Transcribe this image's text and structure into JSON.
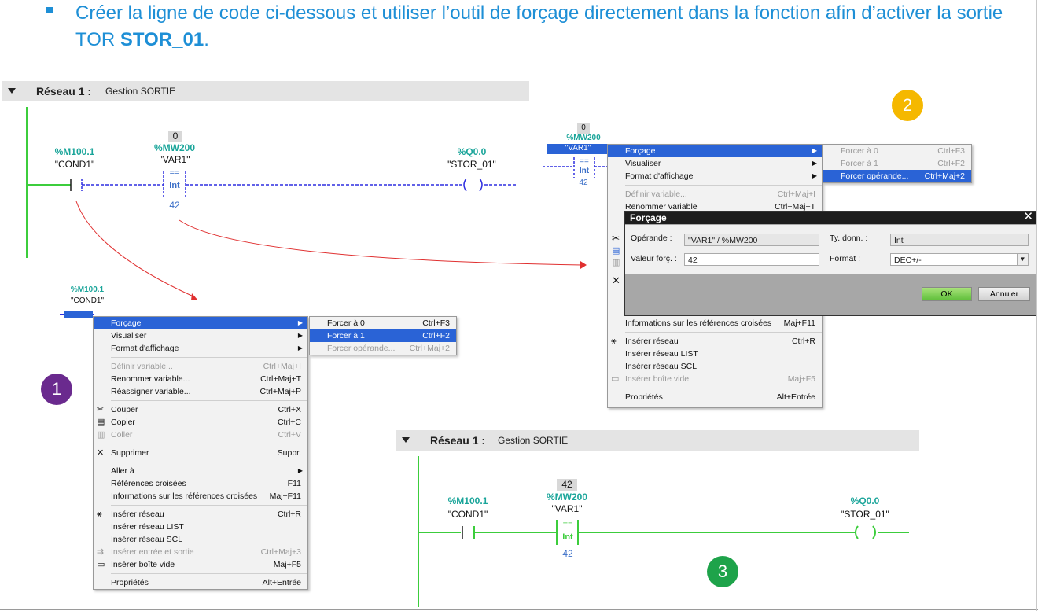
{
  "instruction": {
    "text_before": "Créer la ligne de code ci-dessous et utiliser l’outil de forçage directement dans la fonction afin d’activer la sortie TOR ",
    "bold": "STOR_01",
    "text_after": "."
  },
  "net_left": {
    "label": "Réseau 1 :",
    "name": "Gestion SORTIE"
  },
  "net_bottom": {
    "label": "Réseau 1 :",
    "name": "Gestion SORTIE"
  },
  "rung_top": {
    "contact_addr": "%M100.1",
    "contact_sym": "\"COND1\"",
    "cmp_box": "0",
    "cmp_addr": "%MW200",
    "cmp_sym": "\"VAR1\"",
    "cmp_op": "==",
    "cmp_type": "Int",
    "cmp_value": "42",
    "coil_addr": "%Q0.0",
    "coil_sym": "\"STOR_01\""
  },
  "rung_right": {
    "box": "0",
    "addr": "%MW200",
    "sym": "\"VAR1\"",
    "op": "==",
    "type": "Int",
    "value": "42"
  },
  "rung_small": {
    "addr": "%M100.1",
    "sym": "\"COND1\""
  },
  "rung_bottom": {
    "contact_addr": "%M100.1",
    "contact_sym": "\"COND1\"",
    "cmp_box": "42",
    "cmp_addr": "%MW200",
    "cmp_sym": "\"VAR1\"",
    "cmp_op": "==",
    "cmp_type": "Int",
    "cmp_value": "42",
    "coil_addr": "%Q0.0",
    "coil_sym": "\"STOR_01\""
  },
  "menu1": [
    {
      "label": "Forçage",
      "key": "",
      "sub": true,
      "hl": true
    },
    {
      "label": "Visualiser",
      "key": "",
      "sub": true
    },
    {
      "label": "Format d'affichage",
      "key": "",
      "sub": true
    },
    {
      "sep": true
    },
    {
      "label": "Définir variable...",
      "key": "Ctrl+Maj+I",
      "dis": true
    },
    {
      "label": "Renommer variable...",
      "key": "Ctrl+Maj+T"
    },
    {
      "label": "Réassigner variable...",
      "key": "Ctrl+Maj+P"
    },
    {
      "sep": true
    },
    {
      "label": "Couper",
      "key": "Ctrl+X",
      "icon": "✂"
    },
    {
      "label": "Copier",
      "key": "Ctrl+C",
      "icon": "▤"
    },
    {
      "label": "Coller",
      "key": "Ctrl+V",
      "dis": true,
      "icon": "▥"
    },
    {
      "sep": true
    },
    {
      "label": "Supprimer",
      "key": "Suppr.",
      "icon": "✕"
    },
    {
      "sep": true
    },
    {
      "label": "Aller à",
      "key": "",
      "sub": true
    },
    {
      "label": "Références croisées",
      "key": "F11"
    },
    {
      "label": "Informations sur les références croisées",
      "key": "Maj+F11"
    },
    {
      "sep": true
    },
    {
      "label": "Insérer réseau",
      "key": "Ctrl+R",
      "icon": "⚹"
    },
    {
      "label": "Insérer réseau LIST",
      "key": ""
    },
    {
      "label": "Insérer réseau SCL",
      "key": ""
    },
    {
      "label": "Insérer entrée et sortie",
      "key": "Ctrl+Maj+3",
      "dis": true,
      "icon": "⇉"
    },
    {
      "label": "Insérer boîte vide",
      "key": "Maj+F5",
      "icon": "▭"
    },
    {
      "sep": true
    },
    {
      "label": "Propriétés",
      "key": "Alt+Entrée"
    }
  ],
  "submenu1": [
    {
      "label": "Forcer à 0",
      "key": "Ctrl+F3"
    },
    {
      "label": "Forcer à 1",
      "key": "Ctrl+F2",
      "hl": true
    },
    {
      "label": "Forcer opérande...",
      "key": "Ctrl+Maj+2",
      "dis": true
    }
  ],
  "menu2_top": [
    {
      "label": "Forçage",
      "key": "",
      "sub": true,
      "hl": true
    },
    {
      "label": "Visualiser",
      "key": "",
      "sub": true
    },
    {
      "label": "Format d'affichage",
      "key": "",
      "sub": true
    },
    {
      "sep": true
    },
    {
      "label": "Définir variable...",
      "key": "Ctrl+Maj+I",
      "dis": true
    },
    {
      "label": "Renommer variable",
      "key": "Ctrl+Maj+T"
    }
  ],
  "menu2_bottom": [
    {
      "label": "Informations sur les références croisées",
      "key": "Maj+F11"
    },
    {
      "sep": true
    },
    {
      "label": "Insérer réseau",
      "key": "Ctrl+R",
      "icon": "⚹"
    },
    {
      "label": "Insérer réseau LIST",
      "key": ""
    },
    {
      "label": "Insérer réseau SCL",
      "key": ""
    },
    {
      "label": "Insérer boîte vide",
      "key": "Maj+F5",
      "dis": true,
      "icon": "▭"
    },
    {
      "sep": true
    },
    {
      "label": "Propriétés",
      "key": "Alt+Entrée"
    }
  ],
  "submenu2": [
    {
      "label": "Forcer à 0",
      "key": "Ctrl+F3",
      "dis": true
    },
    {
      "label": "Forcer à 1",
      "key": "Ctrl+F2",
      "dis": true
    },
    {
      "label": "Forcer opérande...",
      "key": "Ctrl+Maj+2",
      "hl": true
    }
  ],
  "dialog": {
    "title": "Forçage",
    "operand_label": "Opérande :",
    "operand_value": "\"VAR1\" / %MW200",
    "type_label": "Ty. donn. :",
    "type_value": "Int",
    "force_label": "Valeur forç. :",
    "force_value": "42",
    "format_label": "Format :",
    "format_value": "DEC+/-",
    "ok": "OK",
    "cancel": "Annuler"
  },
  "steps": {
    "s1": "1",
    "s2": "2",
    "s3": "3"
  },
  "colors": {
    "step1": "#6a2a8e",
    "step2": "#f5b800",
    "step3": "#1ea34a",
    "rail": "#3ccd3c",
    "link": "#2e2ee0",
    "highlight": "#2a63d6"
  }
}
